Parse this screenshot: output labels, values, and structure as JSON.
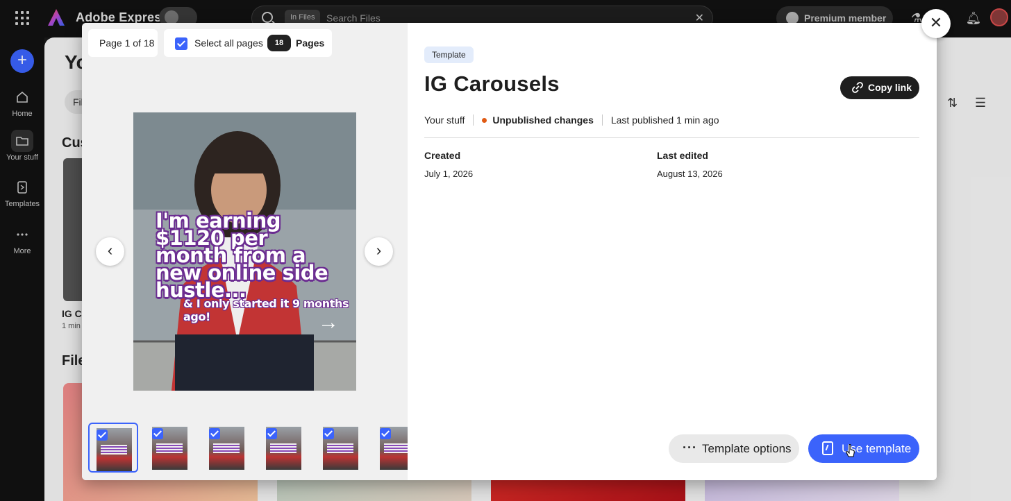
{
  "app": {
    "name": "Adobe Express",
    "search_scope": "In Files",
    "search_placeholder": "Search Files",
    "premium_label": "Premium member"
  },
  "rail": {
    "items": [
      {
        "label": "Home"
      },
      {
        "label": "Your stuff"
      },
      {
        "label": "Templates"
      },
      {
        "label": "More"
      }
    ]
  },
  "background": {
    "title": "Yo",
    "filter_label": "Fil",
    "section1": "Cus",
    "card_name": "IG Ca",
    "card_time": "1 min",
    "section2": "File"
  },
  "modal": {
    "page_indicator": "Page 1 of 18",
    "select_all_label": "Select all pages",
    "selected_count": "18",
    "pages_label": "Pages",
    "preview": {
      "headline": "I'm earning $1120 per month from a new online side hustle...",
      "subline": "& I only started it 9 months ago!",
      "arrow": "→"
    },
    "tag": "Template",
    "title": "IG Carousels",
    "copy_link": "Copy link",
    "location": "Your stuff",
    "status": "Unpublished changes",
    "last_published": "Last published 1 min ago",
    "created_label": "Created",
    "created_value": "July 1, 2026",
    "edited_label": "Last edited",
    "edited_value": "August 13, 2026",
    "template_options": "Template options",
    "use_template": "Use template"
  },
  "colors": {
    "accent": "#3b63fb",
    "status_dot": "#e05a13",
    "tag_bg": "#e3ecfb"
  }
}
